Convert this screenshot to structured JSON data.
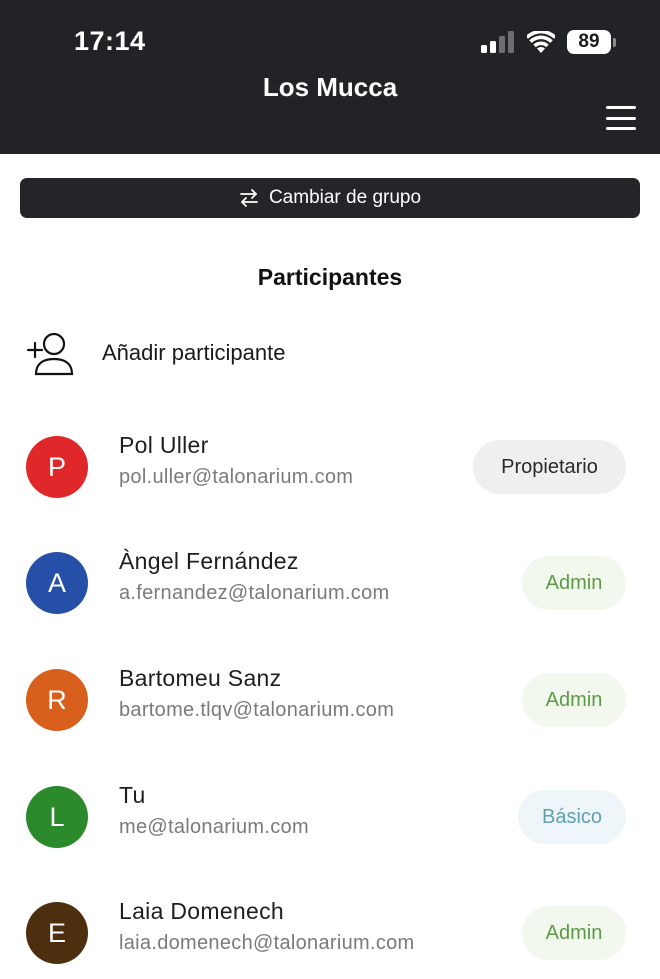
{
  "status_bar": {
    "time": "17:14",
    "battery": "89"
  },
  "header": {
    "title": "Los Mucca"
  },
  "switch_group": {
    "label": "Cambiar de grupo"
  },
  "section": {
    "title": "Participantes"
  },
  "add_participant": {
    "label": "Añadir participante"
  },
  "participants": [
    {
      "initial": "P",
      "name": "Pol Uller",
      "email": "pol.uller@talonarium.com",
      "role": "Propietario",
      "avatar_color": "#e0282b"
    },
    {
      "initial": "A",
      "name": "Àngel Fernández",
      "email": "a.fernandez@talonarium.com",
      "role": "Admin",
      "avatar_color": "#2650a8"
    },
    {
      "initial": "R",
      "name": "Bartomeu Sanz",
      "email": "bartome.tlqv@talonarium.com",
      "role": "Admin",
      "avatar_color": "#d85f1c"
    },
    {
      "initial": "L",
      "name": "Tu",
      "email": "me@talonarium.com",
      "role": "Básico",
      "avatar_color": "#2b8a2b"
    },
    {
      "initial": "E",
      "name": "Laia Domenech",
      "email": "laia.domenech@talonarium.com",
      "role": "Admin",
      "avatar_color": "#4d2e0f"
    }
  ]
}
